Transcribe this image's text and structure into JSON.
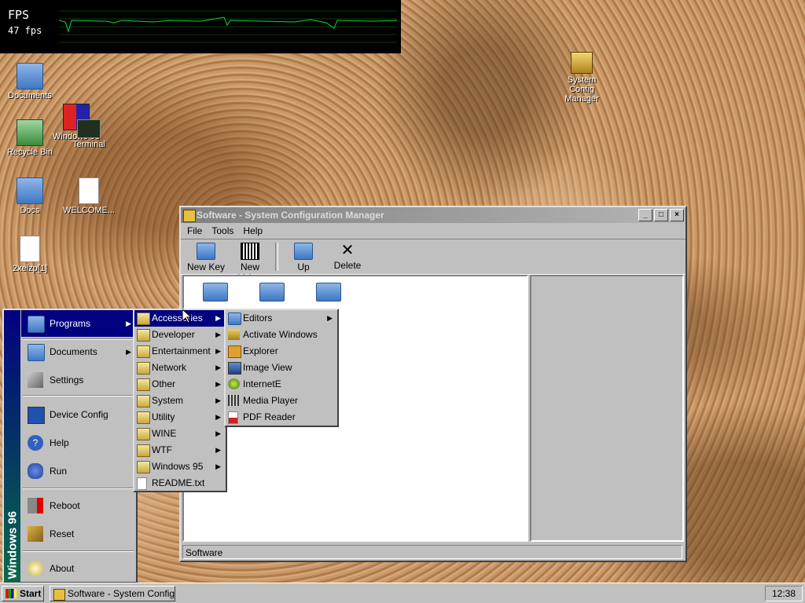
{
  "fps": {
    "label": "FPS",
    "value": "47 fps"
  },
  "desktop_icons": [
    {
      "label": "Documents",
      "icon": "folder-icon"
    },
    {
      "label": "Recycle Bin",
      "icon": "recycle-bin-icon"
    },
    {
      "label": "Windows 95",
      "icon": "vm-icon"
    },
    {
      "label": "Terminal",
      "icon": "terminal-icon"
    },
    {
      "label": "Docs",
      "icon": "folder-icon"
    },
    {
      "label": "WELCOME...",
      "icon": "document-icon"
    },
    {
      "label": "2xelzp[1]",
      "icon": "blank-file-icon"
    },
    {
      "label": "System Config Manager",
      "icon": "config-icon"
    }
  ],
  "window": {
    "title": "Software - System Configuration Manager",
    "menu": [
      "File",
      "Tools",
      "Help"
    ],
    "toolbar": [
      "New Key",
      "New Value",
      "Up",
      "Delete"
    ],
    "status": "Software"
  },
  "start_menu": {
    "sidebar": "Windows 96",
    "items": [
      "Programs",
      "Documents",
      "Settings",
      "Device Config",
      "Help",
      "Run",
      "Reboot",
      "Reset",
      "About"
    ]
  },
  "programs_menu": [
    "Accessories",
    "Developer",
    "Entertainment",
    "Network",
    "Other",
    "System",
    "Utility",
    "WINE",
    "WTF",
    "Windows 95",
    "README.txt"
  ],
  "accessories_menu": [
    "Editors",
    "Activate Windows",
    "Explorer",
    "Image View",
    "InternetE",
    "Media Player",
    "PDF Reader"
  ],
  "taskbar": {
    "start": "Start",
    "task": "Software - System Configur...",
    "clock": "12:38"
  }
}
